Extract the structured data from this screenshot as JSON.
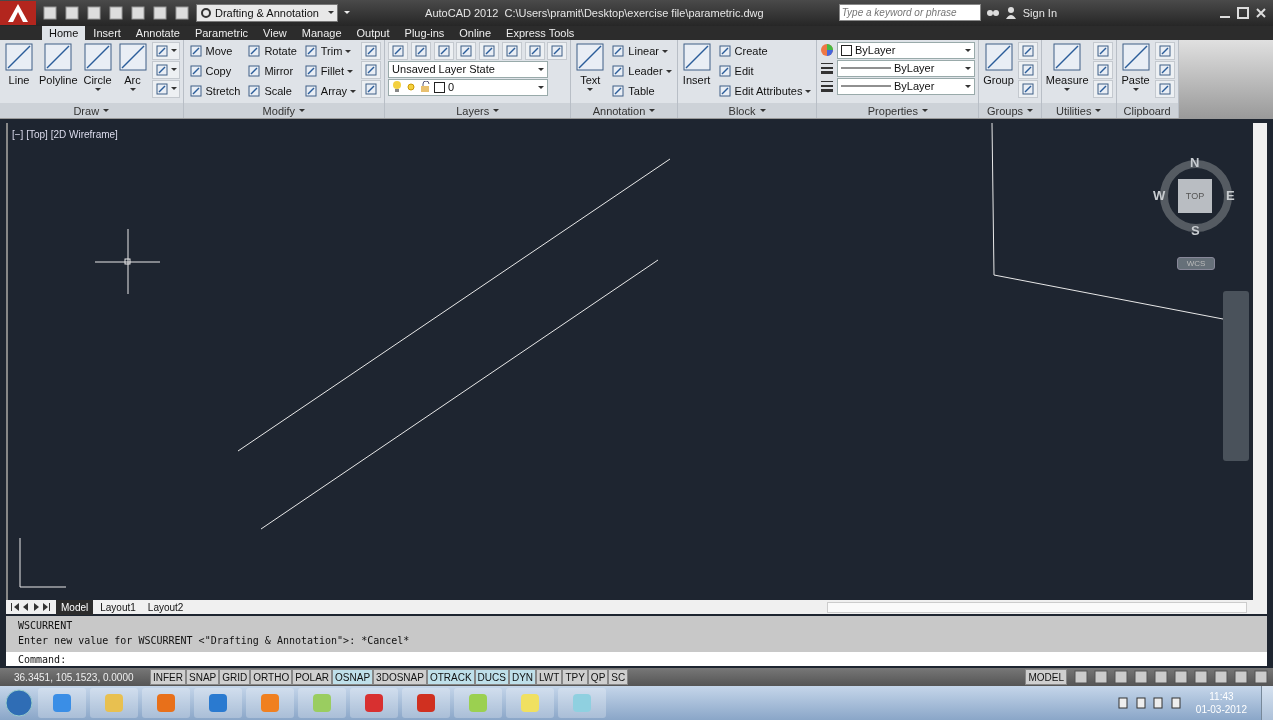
{
  "window": {
    "title": "AutoCAD 2012",
    "path": "C:\\Users\\pramit\\Desktop\\exercise file\\parametric.dwg"
  },
  "workspace": "Drafting & Annotation",
  "search": {
    "placeholder": "Type a keyword or phrase"
  },
  "sign_in": "Sign In",
  "tabs": [
    {
      "label": "Home",
      "selected": true
    },
    {
      "label": "Insert",
      "selected": false
    },
    {
      "label": "Annotate",
      "selected": false
    },
    {
      "label": "Parametric",
      "selected": false
    },
    {
      "label": "View",
      "selected": false
    },
    {
      "label": "Manage",
      "selected": false
    },
    {
      "label": "Output",
      "selected": false
    },
    {
      "label": "Plug-ins",
      "selected": false
    },
    {
      "label": "Online",
      "selected": false
    },
    {
      "label": "Express Tools",
      "selected": false
    }
  ],
  "panels": [
    {
      "title": "Draw",
      "dropdown": true,
      "columns": [
        [
          {
            "kind": "large",
            "label": "Line",
            "dropdown": false
          }
        ],
        [
          {
            "kind": "large",
            "label": "Polyline",
            "dropdown": false
          }
        ],
        [
          {
            "kind": "large",
            "label": "Circle",
            "dropdown": true
          }
        ],
        [
          {
            "kind": "large",
            "label": "Arc",
            "dropdown": true
          }
        ],
        [
          {
            "kind": "icon",
            "dropdown": true
          },
          {
            "kind": "icon",
            "dropdown": true
          },
          {
            "kind": "icon",
            "dropdown": true
          }
        ]
      ]
    },
    {
      "title": "Modify",
      "dropdown": true,
      "columns": [
        [
          {
            "kind": "small",
            "label": "Move",
            "dropdown": false
          },
          {
            "kind": "small",
            "label": "Copy",
            "dropdown": false
          },
          {
            "kind": "small",
            "label": "Stretch",
            "dropdown": false
          }
        ],
        [
          {
            "kind": "small",
            "label": "Rotate",
            "dropdown": false
          },
          {
            "kind": "small",
            "label": "Mirror",
            "dropdown": false
          },
          {
            "kind": "small",
            "label": "Scale",
            "dropdown": false
          }
        ],
        [
          {
            "kind": "small",
            "label": "Trim",
            "dropdown": true
          },
          {
            "kind": "small",
            "label": "Fillet",
            "dropdown": true
          },
          {
            "kind": "small",
            "label": "Array",
            "dropdown": true
          }
        ],
        [
          {
            "kind": "icon",
            "dropdown": false
          },
          {
            "kind": "icon",
            "dropdown": false
          },
          {
            "kind": "icon",
            "dropdown": false
          }
        ]
      ]
    },
    {
      "title": "Layers",
      "dropdown": true,
      "columns": [
        [
          {
            "kind": "iconrow"
          },
          {
            "kind": "combo",
            "value": "Unsaved Layer State"
          },
          {
            "kind": "layer",
            "value": "0"
          }
        ]
      ]
    },
    {
      "title": "Annotation",
      "dropdown": true,
      "columns": [
        [
          {
            "kind": "large",
            "label": "Text",
            "dropdown": true
          }
        ],
        [
          {
            "kind": "small",
            "label": "Linear",
            "dropdown": true
          },
          {
            "kind": "small",
            "label": "Leader",
            "dropdown": true
          },
          {
            "kind": "small",
            "label": "Table",
            "dropdown": false
          }
        ]
      ]
    },
    {
      "title": "Block",
      "dropdown": true,
      "columns": [
        [
          {
            "kind": "large",
            "label": "Insert",
            "dropdown": false
          }
        ],
        [
          {
            "kind": "small",
            "label": "Create",
            "dropdown": false
          },
          {
            "kind": "small",
            "label": "Edit",
            "dropdown": false
          },
          {
            "kind": "small",
            "label": "Edit Attributes",
            "dropdown": true
          }
        ]
      ]
    },
    {
      "title": "Properties",
      "dropdown": true,
      "columns": [
        [
          {
            "kind": "colorcombo",
            "value": "ByLayer"
          },
          {
            "kind": "linecombo",
            "value": "ByLayer"
          },
          {
            "kind": "linecombo",
            "value": "ByLayer"
          }
        ]
      ]
    },
    {
      "title": "Groups",
      "dropdown": true,
      "columns": [
        [
          {
            "kind": "large",
            "label": "Group",
            "dropdown": false
          }
        ],
        [
          {
            "kind": "icon",
            "dropdown": false
          },
          {
            "kind": "icon",
            "dropdown": false
          },
          {
            "kind": "icon",
            "dropdown": false
          }
        ]
      ]
    },
    {
      "title": "Utilities",
      "dropdown": true,
      "columns": [
        [
          {
            "kind": "large",
            "label": "Measure",
            "dropdown": true
          }
        ],
        [
          {
            "kind": "icon",
            "dropdown": false
          },
          {
            "kind": "icon",
            "dropdown": false
          },
          {
            "kind": "icon",
            "dropdown": false
          }
        ]
      ]
    },
    {
      "title": "Clipboard",
      "dropdown": false,
      "columns": [
        [
          {
            "kind": "large",
            "label": "Paste",
            "dropdown": true
          }
        ],
        [
          {
            "kind": "icon",
            "dropdown": false
          },
          {
            "kind": "icon",
            "dropdown": false
          },
          {
            "kind": "icon",
            "dropdown": false
          }
        ]
      ]
    }
  ],
  "viewport": {
    "label": "[−] [Top] [2D Wireframe]",
    "compass": {
      "north": "N",
      "south": "S",
      "east": "E",
      "west": "W",
      "face": "TOP"
    },
    "ucs": "WCS"
  },
  "layout_tabs": [
    {
      "label": "Model",
      "selected": true
    },
    {
      "label": "Layout1",
      "selected": false
    },
    {
      "label": "Layout2",
      "selected": false
    }
  ],
  "command_history": [
    "WSCURRENT",
    "Enter new value for WSCURRENT <\"Drafting & Annotation\">: *Cancel*"
  ],
  "command_prompt": "Command:",
  "status_bar": {
    "coordinates": "36.3451, 105.1523, 0.0000",
    "toggles": [
      {
        "label": "INFER",
        "on": false
      },
      {
        "label": "SNAP",
        "on": false
      },
      {
        "label": "GRID",
        "on": false
      },
      {
        "label": "ORTHO",
        "on": false
      },
      {
        "label": "POLAR",
        "on": false
      },
      {
        "label": "OSNAP",
        "on": true
      },
      {
        "label": "3DOSNAP",
        "on": false
      },
      {
        "label": "OTRACK",
        "on": true
      },
      {
        "label": "DUCS",
        "on": true
      },
      {
        "label": "DYN",
        "on": true
      },
      {
        "label": "LWT",
        "on": false
      },
      {
        "label": "TPY",
        "on": false
      },
      {
        "label": "QP",
        "on": false
      },
      {
        "label": "SC",
        "on": false
      }
    ],
    "space": "MODEL"
  },
  "taskbar": {
    "time": "11:43",
    "date": "01-03-2012"
  }
}
